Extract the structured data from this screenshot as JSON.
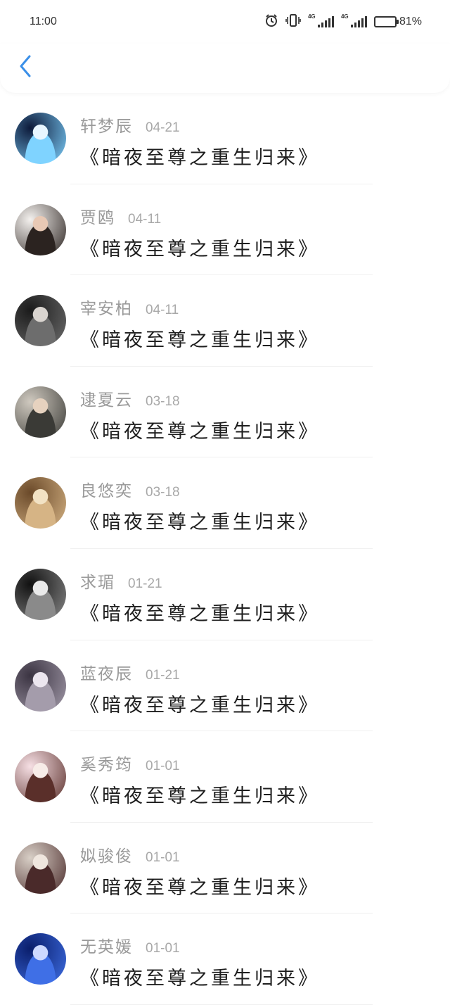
{
  "status_bar": {
    "time": "11:00",
    "network_1": "4G",
    "network_2": "4G",
    "battery": "81%",
    "battery_level": 0.81,
    "icons": [
      "alarm-icon",
      "vibrate-icon",
      "signal-icon",
      "signal-icon",
      "battery-icon"
    ]
  },
  "header": {
    "back_icon": "chevron-left-icon",
    "accent_color": "#3a8fe8"
  },
  "comments": [
    {
      "name": "轩梦辰",
      "date": "04-21",
      "title": "《暗夜至尊之重生归来》",
      "avatar_colors": [
        "#0d1a3a",
        "#7fd3ff",
        "#e8f6ff"
      ]
    },
    {
      "name": "贾鸥",
      "date": "04-11",
      "title": "《暗夜至尊之重生归来》",
      "avatar_colors": [
        "#f4f1ee",
        "#2b2320",
        "#e8c9b5"
      ]
    },
    {
      "name": "宰安柏",
      "date": "04-11",
      "title": "《暗夜至尊之重生归来》",
      "avatar_colors": [
        "#1b1b1b",
        "#6d6d6d",
        "#d9d4cf"
      ]
    },
    {
      "name": "逮夏云",
      "date": "03-18",
      "title": "《暗夜至尊之重生归来》",
      "avatar_colors": [
        "#cfc9bf",
        "#3a3a36",
        "#e6d2bf"
      ]
    },
    {
      "name": "良悠奕",
      "date": "03-18",
      "title": "《暗夜至尊之重生归来》",
      "avatar_colors": [
        "#6b4a2a",
        "#d6b485",
        "#f2e2c4"
      ]
    },
    {
      "name": "求瑂",
      "date": "01-21",
      "title": "《暗夜至尊之重生归来》",
      "avatar_colors": [
        "#111111",
        "#8a8a8a",
        "#e9e9e9"
      ]
    },
    {
      "name": "蓝夜辰",
      "date": "01-21",
      "title": "《暗夜至尊之重生归来》",
      "avatar_colors": [
        "#3b3442",
        "#a49cab",
        "#ece6ef"
      ]
    },
    {
      "name": "奚秀筠",
      "date": "01-01",
      "title": "《暗夜至尊之重生归来》",
      "avatar_colors": [
        "#f6dfe4",
        "#5a2f2a",
        "#f7ece8"
      ]
    },
    {
      "name": "姒骏俊",
      "date": "01-01",
      "title": "《暗夜至尊之重生归来》",
      "avatar_colors": [
        "#d8cfc6",
        "#4a2a2a",
        "#efe6de"
      ]
    },
    {
      "name": "无英媛",
      "date": "01-01",
      "title": "《暗夜至尊之重生归来》",
      "avatar_colors": [
        "#0a1e6b",
        "#3f6fe6",
        "#cdd9ff"
      ]
    }
  ]
}
